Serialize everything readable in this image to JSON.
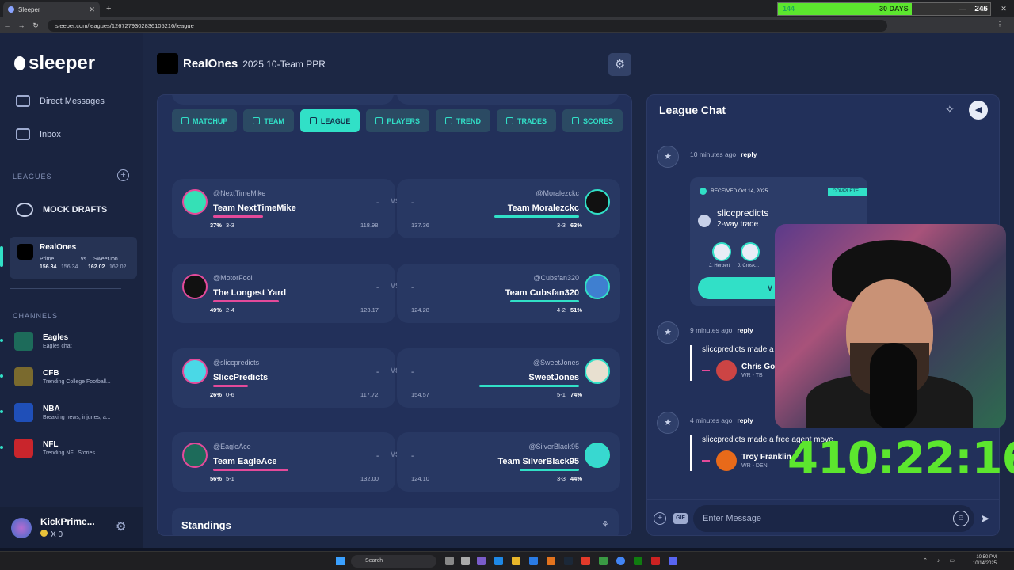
{
  "browser": {
    "tab_title": "Sleeper",
    "url": "sleeper.com/leagues/1267279302836105216/league",
    "timer_left": "144",
    "timer_mid": "30 DAYS",
    "timer_right": "246",
    "timer_fill_fraction": 0.63
  },
  "sidebar": {
    "logo": "sleeper",
    "direct_messages": "Direct Messages",
    "inbox": "Inbox",
    "leagues_label": "LEAGUES",
    "mock_drafts": "MOCK DRAFTS",
    "league_card": {
      "name": "RealOnes",
      "left_team": "Prime",
      "vs": "vs.",
      "right_team": "SweetJon...",
      "left_score": "156.34",
      "left_proj": "156.34",
      "right_score": "162.02",
      "right_proj": "162.02"
    },
    "channels_label": "CHANNELS",
    "channels": [
      {
        "name": "Eagles",
        "sub": "Eagles chat",
        "color": "#1d6b5a"
      },
      {
        "name": "CFB",
        "sub": "Trending College Football...",
        "color": "#7a6a2e"
      },
      {
        "name": "NBA",
        "sub": "Breaking news, injuries, a...",
        "color": "#1f4fb8"
      },
      {
        "name": "NFL",
        "sub": "Trending NFL Stories",
        "color": "#c9252c"
      }
    ],
    "user": {
      "name": "KickPrime...",
      "coins": "X 0"
    }
  },
  "header": {
    "title": "RealOnes",
    "subtitle": "2025 10-Team PPR"
  },
  "tabs": [
    "MATCHUP",
    "TEAM",
    "LEAGUE",
    "PLAYERS",
    "TREND",
    "TRADES",
    "SCORES"
  ],
  "matchups": [
    {
      "l_handle": "@NextTimeMike",
      "l_team": "Team NextTimeMike",
      "l_pct": "37%",
      "l_rec": "3-3",
      "l_pts": "118.98",
      "l_score": "-",
      "l_fill": 0.37,
      "vs": "VS",
      "r_handle": "@Moralezckc",
      "r_team": "Team Moralezckc",
      "r_pct": "63%",
      "r_rec": "3-3",
      "r_pts": "137.36",
      "r_score": "-",
      "r_fill": 0.63
    },
    {
      "l_handle": "@MotorFool",
      "l_team": "The Longest Yard",
      "l_pct": "49%",
      "l_rec": "2-4",
      "l_pts": "123.17",
      "l_score": "-",
      "l_fill": 0.49,
      "vs": "VS",
      "r_handle": "@Cubsfan320",
      "r_team": "Team Cubsfan320",
      "r_pct": "51%",
      "r_rec": "4-2",
      "r_pts": "124.28",
      "r_score": "-",
      "r_fill": 0.51
    },
    {
      "l_handle": "@sliccpredicts",
      "l_team": "SliccPredicts",
      "l_pct": "26%",
      "l_rec": "0-6",
      "l_pts": "117.72",
      "l_score": "-",
      "l_fill": 0.26,
      "vs": "VS",
      "r_handle": "@SweetJones",
      "r_team": "SweetJones",
      "r_pct": "74%",
      "r_rec": "5-1",
      "r_pts": "154.57",
      "r_score": "-",
      "r_fill": 0.74
    },
    {
      "l_handle": "@EagleAce",
      "l_team": "Team EagleAce",
      "l_pct": "56%",
      "l_rec": "5-1",
      "l_pts": "132.00",
      "l_score": "-",
      "l_fill": 0.56,
      "vs": "VS",
      "r_handle": "@SilverBlack95",
      "r_team": "Team SilverBlack95",
      "r_pct": "44%",
      "r_rec": "3-3",
      "r_pts": "124.10",
      "r_score": "-",
      "r_fill": 0.44
    }
  ],
  "standings": "Standings",
  "chat": {
    "title": "League Chat",
    "msg1_time": "10 minutes ago",
    "reply": "reply",
    "trade": {
      "received": "RECEIVED Oct 14, 2025",
      "status": "COMPLETE",
      "user": "sliccpredicts",
      "type": "2-way trade",
      "p1": "J. Herbert",
      "p2": "J. Crosk...",
      "view": "V"
    },
    "msg2_time": "9 minutes ago",
    "msg2_text": "sliccpredicts made a",
    "msg2_player": "Chris God",
    "msg2_pos": "WR - TB",
    "msg3_time": "4 minutes ago",
    "msg3_text": "sliccpredicts made a free agent move.",
    "msg3_player": "Troy Franklin",
    "msg3_pos": "WR - DEN",
    "input_placeholder": "Enter Message",
    "gif": "GIF"
  },
  "overlay_counter": "410:22:16",
  "taskbar": {
    "search": "Search",
    "time": "10:50 PM",
    "date": "10/14/2025"
  }
}
